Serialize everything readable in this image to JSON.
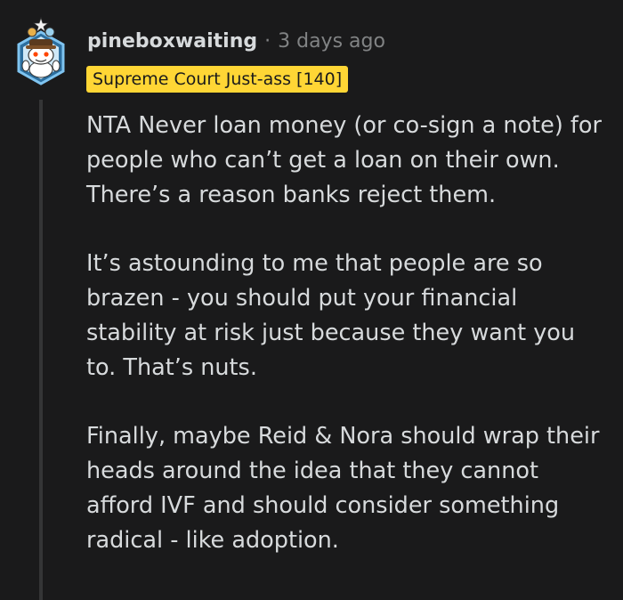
{
  "comment": {
    "author": "pineboxwaiting",
    "separator": "·",
    "timestamp": "3 days ago",
    "flair": "Supreme Court Just-ass [140]",
    "paragraphs": [
      "NTA Never loan money (or co-sign a note) for people who can’t get a loan on their own. There’s a reason banks reject them.",
      "It’s astounding to me that people are so brazen - you should put your financial stability at risk just because they want you to. That’s nuts.",
      "Finally, maybe Reid & Nora should wrap their heads around the idea that they cannot afford IVF and should consider something radical - like adoption."
    ]
  },
  "icons": {
    "avatar": "snoo-avatar-icon"
  },
  "colors": {
    "background": "#1a1a1b",
    "text": "#d7dadc",
    "meta": "#818384",
    "flair_bg": "#ffd635",
    "thread_line": "#343536"
  }
}
